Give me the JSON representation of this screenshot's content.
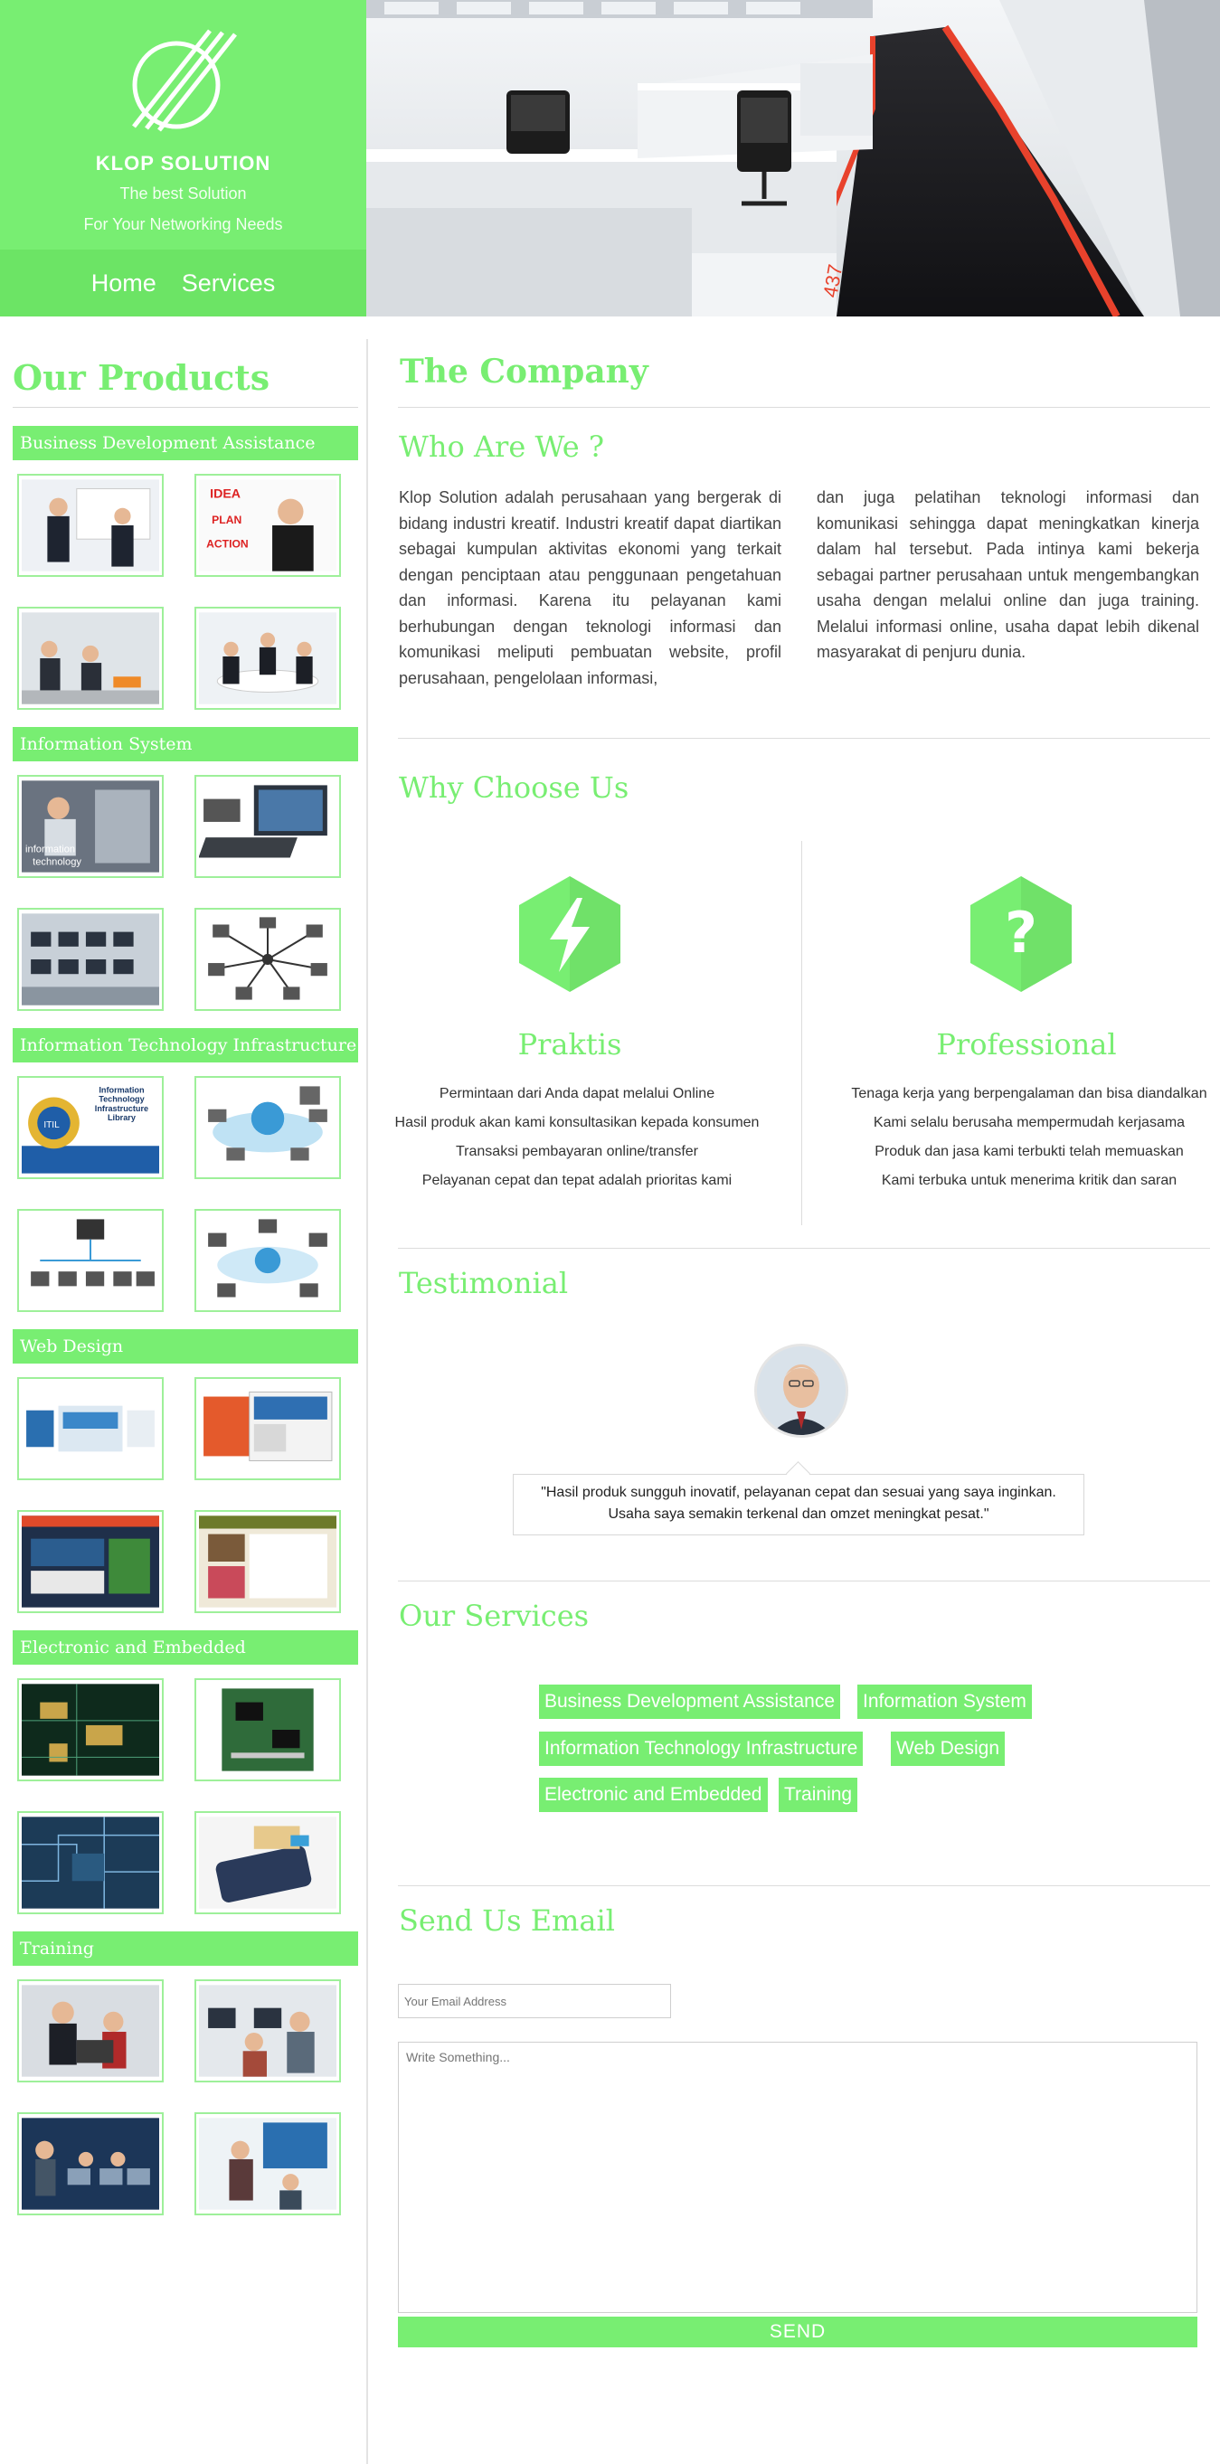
{
  "brand": {
    "name": "KLOP SOLUTION",
    "tagline_1": "The best Solution",
    "tagline_2": "For Your Networking Needs",
    "logo_icon": "slashed-circle-logo"
  },
  "nav": {
    "items": [
      "Home",
      "Services"
    ]
  },
  "sidebar": {
    "title": "Our Products",
    "categories": [
      "Business Development Assistance",
      "Information System",
      "Information Technology Infrastructure",
      "Web Design",
      "Electronic and Embedded",
      "Training"
    ],
    "thumb_text_1": "IDEA",
    "thumb_text_2": "PLAN",
    "thumb_text_3": "ACTION",
    "thumb_text_4": "information",
    "thumb_text_5": "technology",
    "thumb_text_6": "Information Technology Infrastructure Library",
    "thumb_text_7": "ITIL"
  },
  "company": {
    "title": "The Company",
    "who_title": "Who Are We ?",
    "para_left": "Klop Solution adalah perusahaan yang bergerak di bidang industri kreatif. Industri kreatif dapat diartikan sebagai kumpulan aktivitas ekonomi yang terkait dengan penciptaan atau penggunaan pengetahuan dan informasi. Karena itu pelayanan kami berhubungan dengan teknologi informasi dan komunikasi meliputi pembuatan website, profil perusahaan, pengelolaan informasi,",
    "para_right": "dan juga pelatihan teknologi informasi dan komunikasi sehingga dapat meningkatkan kinerja dalam hal tersebut. Pada intinya kami bekerja sebagai partner perusahaan untuk mengembangkan usaha dengan melalui online dan juga training. Melalui informasi online, usaha dapat lebih dikenal masyarakat di penjuru dunia."
  },
  "why": {
    "title": "Why Choose Us",
    "left": {
      "icon": "lightning-bolt-icon",
      "title": "Praktis",
      "points": [
        "Permintaan dari Anda dapat melalui Online",
        "Hasil produk akan kami konsultasikan kepada konsumen",
        "Transaksi pembayaran online/transfer",
        "Pelayanan cepat dan tepat adalah prioritas kami"
      ]
    },
    "right": {
      "icon": "question-mark-icon",
      "title": "Professional",
      "points": [
        "Tenaga kerja yang berpengalaman dan bisa diandalkan",
        "Kami selalu berusaha mempermudah kerjasama",
        "Produk dan jasa kami terbukti telah memuaskan",
        "Kami terbuka untuk menerima kritik dan saran"
      ]
    }
  },
  "testimonial": {
    "title": "Testimonial",
    "quote": "\"Hasil produk sungguh inovatif, pelayanan cepat dan sesuai yang saya inginkan. Usaha saya semakin terkenal dan omzet meningkat pesat.\""
  },
  "services": {
    "title": "Our Services",
    "items": [
      "Business Development Assistance",
      "Information System",
      "Information Technology Infrastructure",
      "Web Design",
      "Electronic and Embedded",
      "Training"
    ]
  },
  "contact": {
    "title": "Send Us Email",
    "email_placeholder": "Your Email Address",
    "message_placeholder": "Write Something...",
    "send_label": "SEND"
  },
  "colors": {
    "accent": "#78ee72",
    "accent_dark": "#6ce465",
    "text": "#333333"
  }
}
